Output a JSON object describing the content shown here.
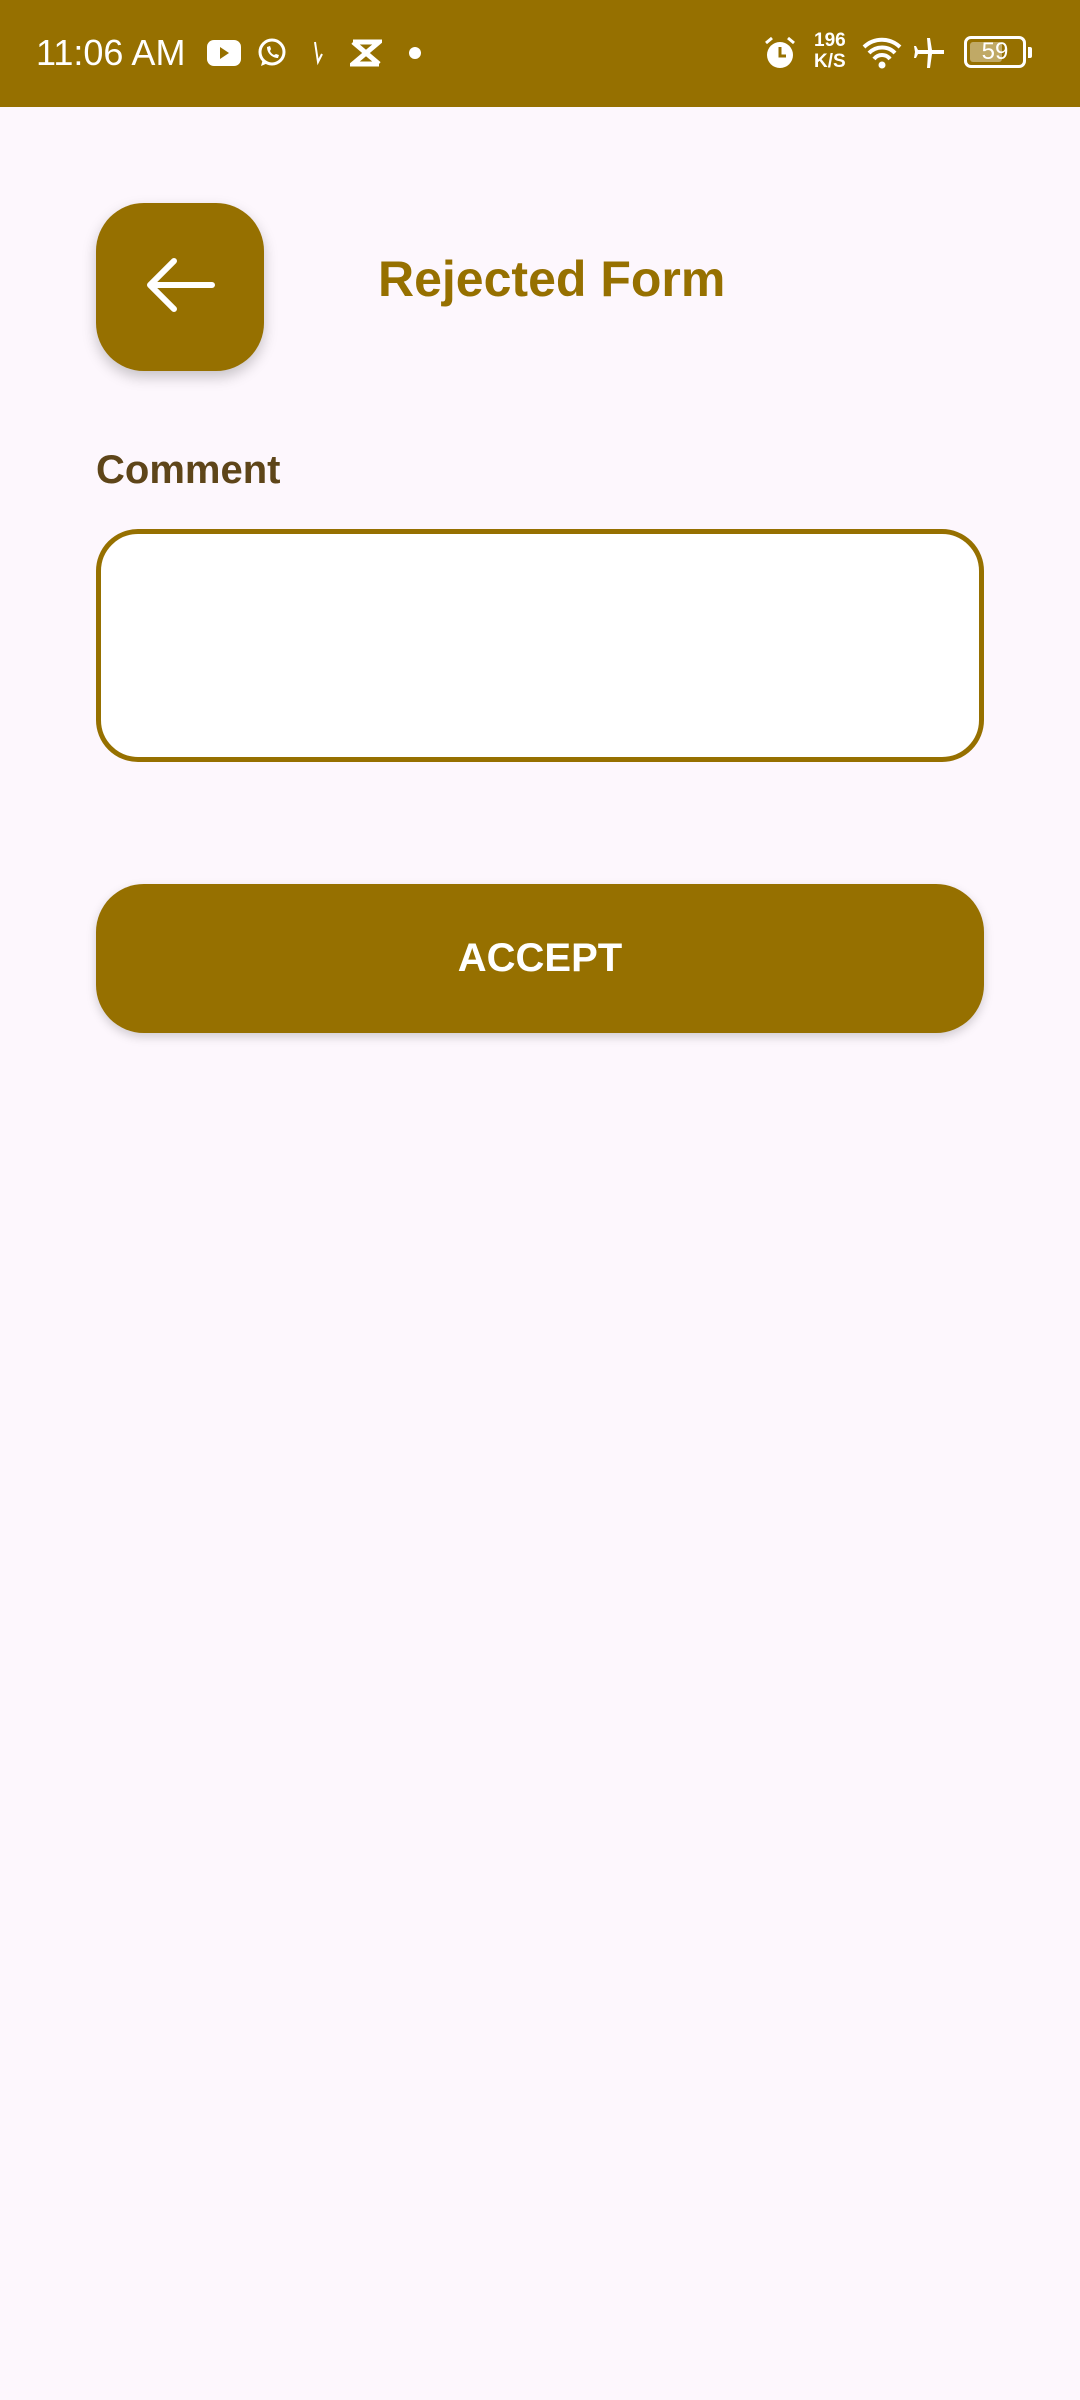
{
  "status_bar": {
    "time": "11:06 AM",
    "net_speed_value": "196",
    "net_speed_unit": "K/S",
    "battery": "59",
    "icons": [
      "youtube-icon",
      "whatsapp-icon",
      "notification-icon",
      "capcut-icon",
      "dot-icon",
      "alarm-icon",
      "wifi-icon",
      "airplane-icon",
      "battery-icon"
    ]
  },
  "header": {
    "title": "Rejected Form",
    "back_icon": "arrow-left-icon"
  },
  "form": {
    "comment_label": "Comment",
    "comment_value": ""
  },
  "actions": {
    "accept_label": "ACCEPT"
  },
  "colors": {
    "primary": "#967000",
    "background": "#fdf7fd",
    "label": "#5e4519"
  }
}
